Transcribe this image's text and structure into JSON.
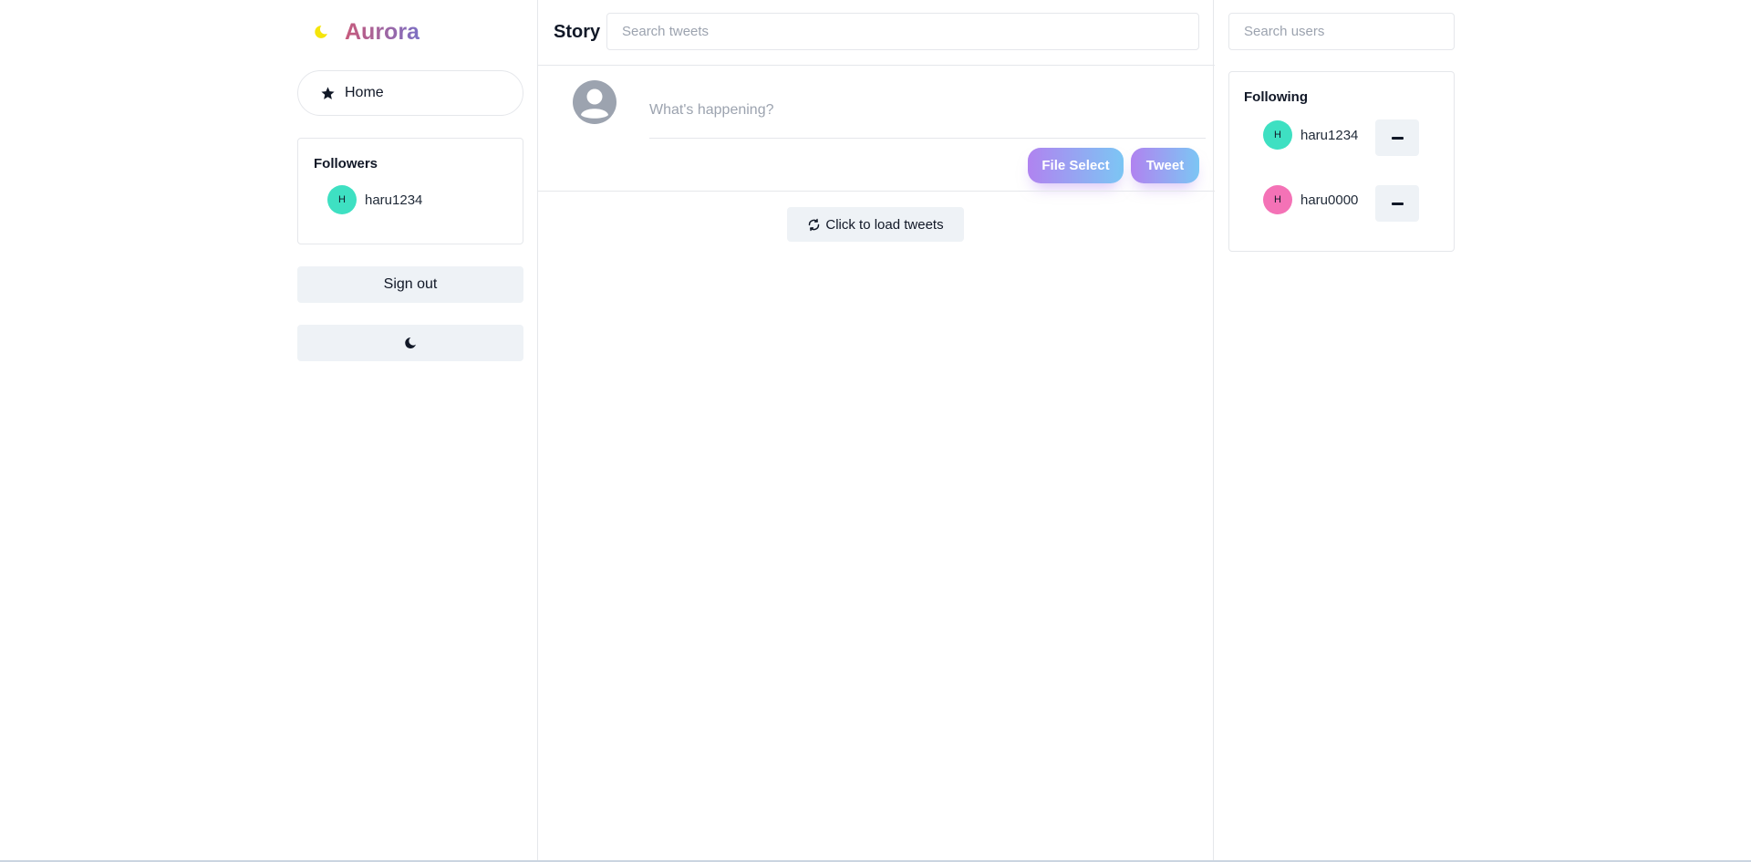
{
  "brand": {
    "title": "Aurora",
    "moon_color": "#f5e50a",
    "title_gradient": [
      "#c75a7b",
      "#7c6fc4"
    ]
  },
  "nav": {
    "home_label": "Home",
    "home_icon": "star-icon"
  },
  "followers": {
    "title": "Followers",
    "items": [
      {
        "initial": "H",
        "username": "haru1234",
        "avatar_color": "#3ee0c2"
      }
    ]
  },
  "sidebar": {
    "sign_out_label": "Sign out",
    "theme_toggle_icon": "moon-icon"
  },
  "story": {
    "title": "Story",
    "search_placeholder": "Search tweets",
    "compose_placeholder": "What's happening?",
    "file_select_label": "File Select",
    "tweet_label": "Tweet",
    "load_label": "Click to load tweets",
    "button_gradient": [
      "#b083f0",
      "#7cc6f4"
    ]
  },
  "right": {
    "search_placeholder": "Search users",
    "following_title": "Following",
    "following": [
      {
        "initial": "H",
        "username": "haru1234",
        "avatar_color": "#3ee0c2"
      },
      {
        "initial": "H",
        "username": "haru0000",
        "avatar_color": "#f472b6"
      }
    ]
  }
}
